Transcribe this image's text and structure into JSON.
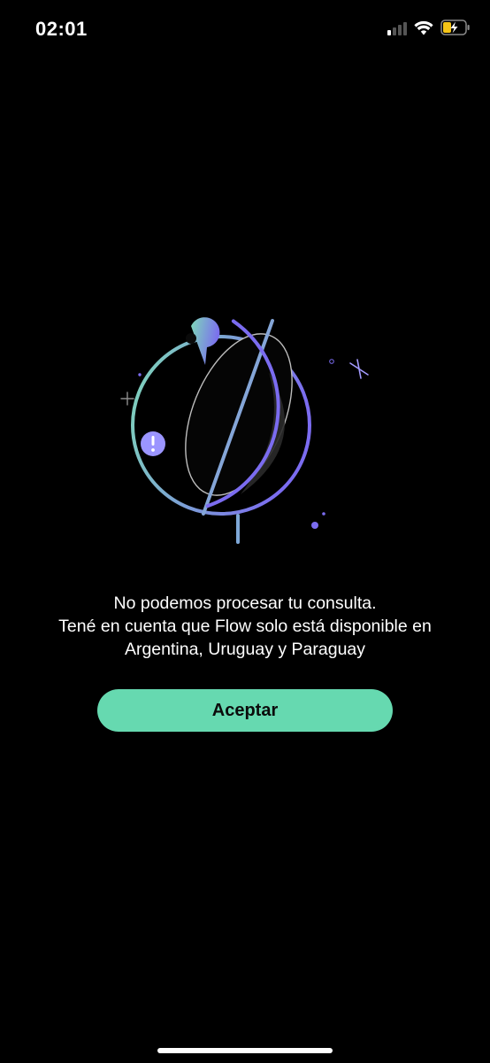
{
  "status_bar": {
    "time": "02:01",
    "signal_bars_active": 1,
    "battery_state": "charging",
    "battery_color": "#f5c518"
  },
  "illustration": {
    "name": "globe-location-error",
    "colors": {
      "gradient_start": "#7ed9b8",
      "gradient_end": "#7b6cf0",
      "accent": "#9b95ff"
    }
  },
  "message": {
    "line1": "No podemos procesar tu consulta.",
    "line2": "Tené en cuenta que Flow solo está disponible en",
    "line3": "Argentina, Uruguay y Paraguay"
  },
  "actions": {
    "accept_label": "Aceptar",
    "accept_color": "#66d9b0"
  }
}
